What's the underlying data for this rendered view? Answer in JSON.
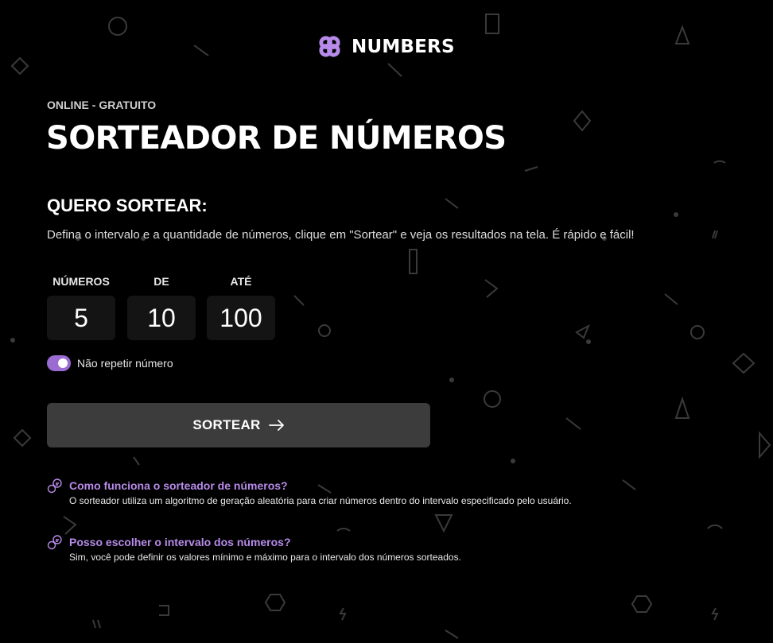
{
  "brand": {
    "name": "NUMBERS",
    "logo_icon": "knot-logo-icon",
    "accent": "#9a6bd1"
  },
  "hero": {
    "eyebrow": "ONLINE - GRATUITO",
    "title": "SORTEADOR DE NÚMEROS"
  },
  "form": {
    "heading": "QUERO SORTEAR:",
    "description": "Defina o intervalo e a quantidade de números, clique em \"Sortear\" e veja os resultados na tela. É rápido e fácil!",
    "fields": [
      {
        "label": "NÚMEROS",
        "value": "5"
      },
      {
        "label": "DE",
        "value": "10"
      },
      {
        "label": "ATÉ",
        "value": "100"
      }
    ],
    "toggle": {
      "label": "Não repetir número",
      "checked": true
    },
    "submit_label": "SORTEAR",
    "submit_icon": "arrow-right-icon"
  },
  "faq": [
    {
      "question": "Como funciona o sorteador de números?",
      "answer": "O sorteador utiliza um algoritmo de geração aleatória para criar números dentro do intervalo especificado pelo usuário."
    },
    {
      "question": "Posso escolher o intervalo dos números?",
      "answer": "Sim, você pode definir os valores mínimo e máximo para o intervalo dos números sorteados."
    }
  ],
  "colors": {
    "background": "#000000",
    "pattern": "#3a3a3a",
    "input_bg": "#141414",
    "button_bg": "#3c3c3c",
    "faq_question": "#b78bea"
  }
}
